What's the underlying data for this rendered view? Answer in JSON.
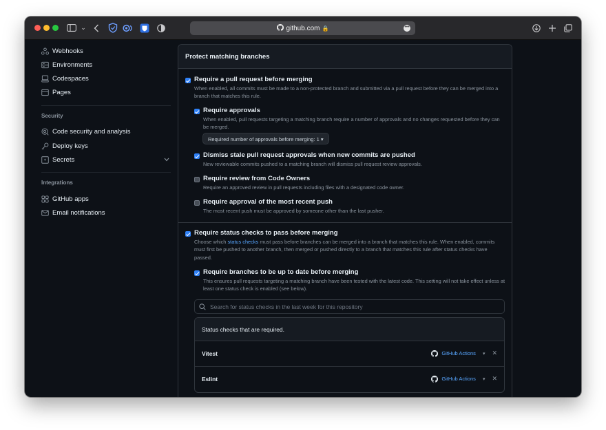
{
  "browser": {
    "url": "github.com",
    "more_glyph": "•••"
  },
  "sidebar": {
    "items_top": [
      {
        "label": "Webhooks",
        "icon": "webhook-icon"
      },
      {
        "label": "Environments",
        "icon": "environments-icon"
      },
      {
        "label": "Codespaces",
        "icon": "codespaces-icon"
      },
      {
        "label": "Pages",
        "icon": "pages-icon"
      }
    ],
    "security_heading": "Security",
    "security_items": [
      {
        "label": "Code security and analysis",
        "icon": "codescan-icon"
      },
      {
        "label": "Deploy keys",
        "icon": "key-icon"
      },
      {
        "label": "Secrets",
        "icon": "secret-icon"
      }
    ],
    "integrations_heading": "Integrations",
    "integrations_items": [
      {
        "label": "GitHub apps",
        "icon": "apps-icon"
      },
      {
        "label": "Email notifications",
        "icon": "mail-icon"
      }
    ]
  },
  "panel": {
    "title": "Protect matching branches",
    "require_pr": {
      "title": "Require a pull request before merging",
      "desc": "When enabled, all commits must be made to a non-protected branch and submitted via a pull request before they can be merged into a branch that matches this rule.",
      "checked": true
    },
    "require_approvals": {
      "title": "Require approvals",
      "desc": "When enabled, pull requests targeting a matching branch require a number of approvals and no changes requested before they can be merged.",
      "checked": true,
      "select_label": "Required number of approvals before merging: 1 ▾"
    },
    "dismiss_stale": {
      "title": "Dismiss stale pull request approvals when new commits are pushed",
      "desc": "New reviewable commits pushed to a matching branch will dismiss pull request review approvals.",
      "checked": true
    },
    "code_owners": {
      "title": "Require review from Code Owners",
      "desc": "Require an approved review in pull requests including files with a designated code owner.",
      "checked": false
    },
    "recent_push": {
      "title": "Require approval of the most recent push",
      "desc": "The most recent push must be approved by someone other than the last pusher.",
      "checked": false
    },
    "status_checks": {
      "title": "Require status checks to pass before merging",
      "desc_pre": "Choose which ",
      "desc_link": "status checks",
      "desc_post": " must pass before branches can be merged into a branch that matches this rule. When enabled, commits must first be pushed to another branch, then merged or pushed directly to a branch that matches this rule after status checks have passed.",
      "checked": true
    },
    "up_to_date": {
      "title": "Require branches to be up to date before merging",
      "desc": "This ensures pull requests targeting a matching branch have been tested with the latest code. This setting will not take effect unless at least one status check is enabled (see below).",
      "checked": true
    },
    "search_placeholder": "Search for status checks in the last week for this repository",
    "required_checks": {
      "heading": "Status checks that are required.",
      "rows": [
        {
          "name": "Vitest",
          "provider": "GitHub Actions"
        },
        {
          "name": "Eslint",
          "provider": "GitHub Actions"
        }
      ]
    }
  },
  "colors": {
    "background": "#0d1117",
    "accent": "#2f81f7",
    "link": "#58a6ff",
    "border": "#30363d"
  }
}
